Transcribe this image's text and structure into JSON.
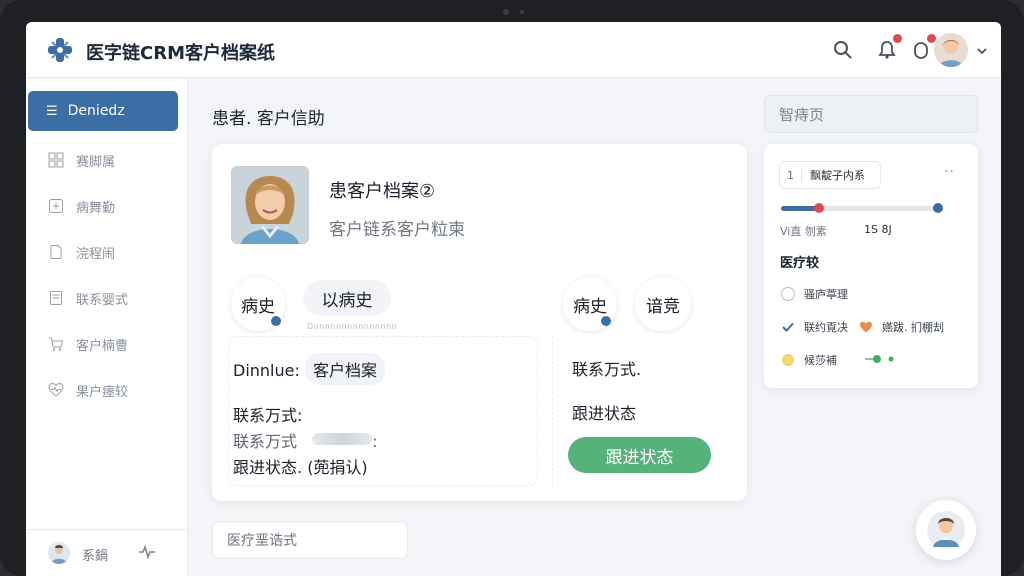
{
  "header": {
    "app_title": "医字链CRM客户档案纸",
    "icons": [
      "search-icon",
      "bell-icon",
      "notification-icon",
      "chevron-down-icon"
    ]
  },
  "sidebar": {
    "active": {
      "label": "Deniedz",
      "icon": "menu-icon"
    },
    "items": [
      {
        "label": "赛脚属",
        "icon": "grid-icon"
      },
      {
        "label": "病舞勤",
        "icon": "plus-box-icon"
      },
      {
        "label": "浣程闹",
        "icon": "document-icon"
      },
      {
        "label": "联系婴式",
        "icon": "bookmark-icon"
      },
      {
        "label": "客户楠曹",
        "icon": "cart-icon"
      },
      {
        "label": "果户瘗较",
        "icon": "heart-pulse-icon"
      }
    ],
    "footer": {
      "label": "系鍋",
      "icon": "pulse-icon"
    }
  },
  "main": {
    "page_title": "患者. 客户信助",
    "card": {
      "title": "患客户档案②",
      "subtitle": "客户链系客户粒柬",
      "pills": [
        "病史",
        "以病史",
        "病史",
        "谙竞"
      ],
      "faint_line": "Dnnnnnnnnnnnnnnn",
      "left": {
        "row1_label": "Dinnlue:",
        "row1_value": "客户档案",
        "row2": "联系万式:",
        "row3": "联系万式",
        "row3_suffix": ":",
        "row4": "跟进状态.",
        "row4_value": "(蔸捐认)"
      },
      "right": {
        "row1": "联系万式.",
        "row2": "跟进状态",
        "status_button": "跟进状态"
      }
    },
    "bottom_input_placeholder": "医疗垩诰式"
  },
  "right_panel": {
    "search_placeholder": "智痔页",
    "chip": {
      "num": "1",
      "label": "飘靛子内系"
    },
    "stat_left": "Vi直 刎素",
    "stat_right": "1S 8J",
    "section_title": "医疗较",
    "progress": 0.24,
    "rows": [
      {
        "label": "骚庐葶理",
        "mark": "empty-circle-icon",
        "extra": ""
      },
      {
        "label": "联约覔决",
        "mark": "check-icon",
        "extra": "嬿跋. 扪棚刦"
      },
      {
        "label": "候莎補",
        "mark": "yellow-dot-icon",
        "extra": ""
      }
    ]
  },
  "colors": {
    "primary": "#3b6ea5",
    "success": "#55b27a",
    "danger": "#e0494a",
    "accent_orange": "#f08a4b"
  }
}
